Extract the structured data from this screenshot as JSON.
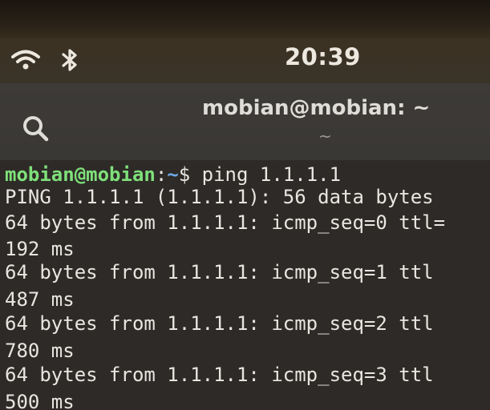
{
  "status": {
    "time": "20:39",
    "icons": [
      "wifi-icon",
      "bluetooth-icon"
    ]
  },
  "header": {
    "title": "mobian@mobian: ~",
    "subtitle": "~",
    "search_icon": "search-icon"
  },
  "terminal": {
    "prompt_user": "mobian@mobian",
    "prompt_sep": ":",
    "prompt_path": "~",
    "prompt_symbol": "$",
    "command": " ping 1.1.1.1",
    "lines": [
      "PING 1.1.1.1 (1.1.1.1): 56 data bytes",
      "64 bytes from 1.1.1.1: icmp_seq=0 ttl=",
      "192 ms",
      "64 bytes from 1.1.1.1: icmp_seq=1 ttl",
      "487 ms",
      "64 bytes from 1.1.1.1: icmp_seq=2 ttl",
      "780 ms",
      "64 bytes from 1.1.1.1: icmp_seq=3 ttl",
      "500 ms"
    ]
  },
  "colors": {
    "prompt_user": "#7fe07a",
    "prompt_path": "#6fa8e8",
    "terminal_bg": "#2d2a27",
    "text": "#e8e6e1"
  }
}
